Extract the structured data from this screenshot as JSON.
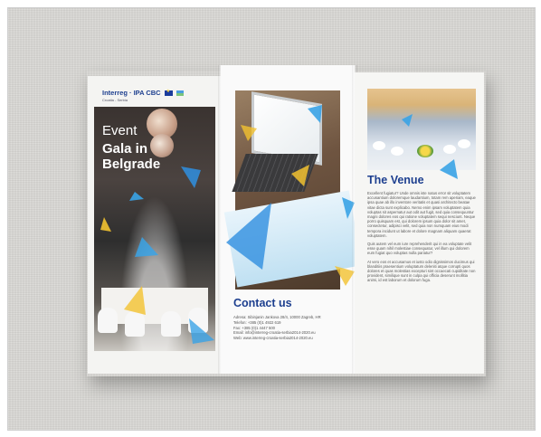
{
  "brochure": {
    "brand": "Interreg · IPA CBC",
    "brand_sub": "Croatia - Serbia",
    "event_line1": "Event",
    "event_line2": "Gala in Belgrade",
    "contact_title": "Contact us",
    "contact_lines": [
      "Adresa: Sibinjanin Jankova 28/4, 10000 Zagreb, HR",
      "Telefon: +385 (0)1 4922 619",
      "Fax: +385 (0)1 4447 500",
      "Email: info@interreg-croatia-serbia2014-2020.eu",
      "Web: www.interreg-croatia-serbia2014-2020.eu"
    ],
    "venue_title": "The Venue",
    "venue_paragraphs": [
      "Excellent fugiatur? Unde omnis iste natus error sit voluptatem accusantium doloremque laudantium, totam rem aperiam, eaque ipsa quae ab illo inventore veritatis et quasi architecto beatae vitae dicta sunt explicabo. Nemo enim ipsam voluptatem quia voluptas sit aspernatur aut odit aut fugit, sed quia consequuntur magni dolores eos qui ratione voluptatem sequi nesciunt. Neque porro quisquam est, qui dolorem ipsum quia dolor sit amet, consectetur, adipisci velit, sed quia non numquam eius modi tempora incidunt ut labore et dolore magnam aliquam quaerat voluptatem.",
      "Quis autem vel eum iure reprehenderit qui in ea voluptate velit esse quam nihil molestiae consequatur, vel illum qui dolorem eum fugiat quo voluptas nulla pariatur?",
      "At vero eos et accusamus et iusto odio dignissimos ducimus qui blanditiis praesentium voluptatum deleniti atque corrupti quos dolores et quas molestias excepturi sint occaecati cupiditate non provident, similique sunt in culpa qui officia deserunt mollitia animi, id est laborum et dolorum fuga."
    ]
  },
  "colors": {
    "title_blue": "#1d3f8f",
    "accent_blue": "#3aa3e6",
    "accent_yellow": "#f2c230"
  }
}
